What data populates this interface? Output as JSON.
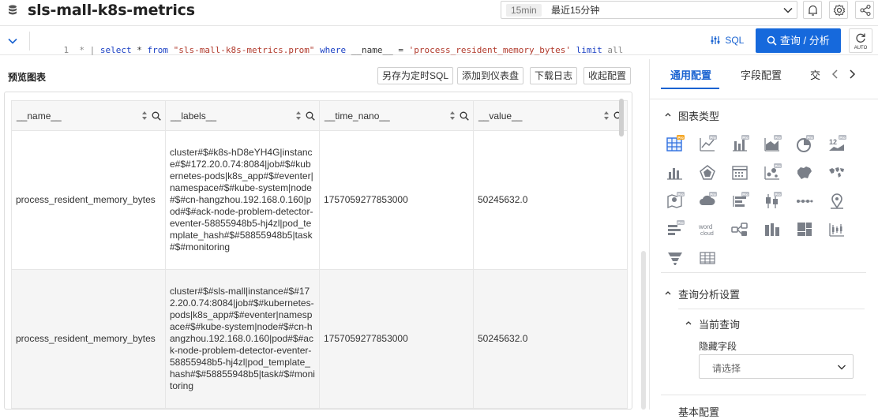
{
  "header": {
    "title": "sls-mall-k8s-metrics",
    "time_badge": "15min",
    "time_label": "最近15分钟"
  },
  "query": {
    "line_number": "1",
    "segments": [
      {
        "t": "* | ",
        "c": "num"
      },
      {
        "t": "select",
        "c": "kw"
      },
      {
        "t": " * ",
        "c": "fn"
      },
      {
        "t": "from",
        "c": "kw"
      },
      {
        "t": " ",
        "c": "fn"
      },
      {
        "t": "\"sls-mall-k8s-metrics.prom\"",
        "c": "str"
      },
      {
        "t": " ",
        "c": "fn"
      },
      {
        "t": "where",
        "c": "kw"
      },
      {
        "t": " __name__ = ",
        "c": "fn"
      },
      {
        "t": "'process_resident_memory_bytes'",
        "c": "str"
      },
      {
        "t": " ",
        "c": "fn"
      },
      {
        "t": "limit",
        "c": "kw"
      },
      {
        "t": " all",
        "c": "num"
      }
    ],
    "sql_label": "SQL",
    "query_button": "查询 / 分析",
    "auto_label": "AUTO"
  },
  "preview": {
    "title": "预览图表",
    "buttons": [
      "另存为定时SQL",
      "添加到仪表盘",
      "下载日志",
      "收起配置"
    ]
  },
  "table": {
    "columns": [
      "__name__",
      "__labels__",
      "__time_nano__",
      "__value__"
    ],
    "rows": [
      [
        "process_resident_memory_bytes",
        "cluster#$#k8s-hD8eYH4G|instance#$#172.20.0.74:8084|job#$#kubernetes-pods|k8s_app#$#eventer|namespace#$#kube-system|node#$#cn-hangzhou.192.168.0.160|pod#$#ack-node-problem-detector-eventer-58855948b5-hj4zl|pod_template_hash#$#58855948b5|task#$#monitoring",
        "1757059277853000",
        "50245632.0"
      ],
      [
        "process_resident_memory_bytes",
        "cluster#$#sls-mall|instance#$#172.20.0.74:8084|job#$#kubernetes-pods|k8s_app#$#eventer|namespace#$#kube-system|node#$#cn-hangzhou.192.168.0.160|pod#$#ack-node-problem-detector-eventer-58855948b5-hj4zl|pod_template_hash#$#58855948b5|task#$#monitoring",
        "1757059277853000",
        "50245632.0"
      ]
    ]
  },
  "right_panel": {
    "tabs": [
      "通用配置",
      "字段配置",
      "交"
    ],
    "chart_type_section": "图表类型",
    "query_analysis_section": "查询分析设置",
    "current_query": "当前查询",
    "hidden_fields_label": "隐藏字段",
    "select_placeholder": "请选择",
    "basic_config_section": "基本配置",
    "chart_icons": [
      "table-chart-pro-icon",
      "line-chart-pro-icon",
      "bar-chart-pro-icon",
      "area-chart-pro-icon",
      "pie-chart-pro-icon",
      "stat-chart-pro-icon",
      "column-chart-icon",
      "radar-chart-icon",
      "calendar-heatmap-icon",
      "scatter-chart-pro-icon",
      "china-map-icon",
      "world-map-icon",
      "map-pin-chart-icon",
      "cloud-map-icon",
      "progress-bar-icon",
      "boxplot-icon",
      "flow-dots-icon",
      "location-pin-icon",
      "list-bar-pro-icon",
      "word-cloud-icon",
      "topology-icon",
      "histogram-icon",
      "treemap-icon",
      "candlestick-icon",
      "funnel-chart-icon",
      "cross-table-icon"
    ]
  }
}
